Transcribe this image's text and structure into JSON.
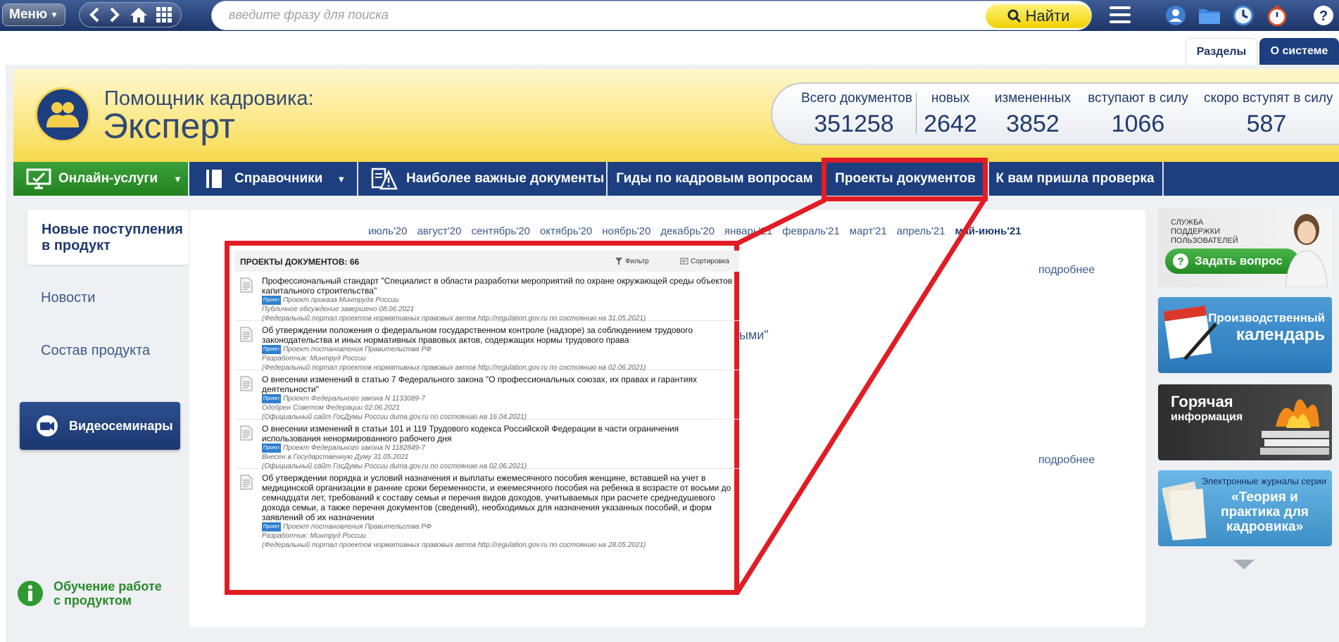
{
  "toolbar": {
    "menu_label": "Меню",
    "search_placeholder": "введите фразу для поиска",
    "search_button": "Найти"
  },
  "tabs": {
    "razdely": "Разделы",
    "o_sisteme": "О системе"
  },
  "brand": {
    "subtitle": "Помощник кадровика:",
    "title": "Эксперт"
  },
  "stats": [
    {
      "label": "Всего документов",
      "value": "351258"
    },
    {
      "label": "новых",
      "value": "2642"
    },
    {
      "label": "измененных",
      "value": "3852"
    },
    {
      "label": "вступают в силу",
      "value": "1066"
    },
    {
      "label": "скоро вступят в силу",
      "value": "587"
    }
  ],
  "nav": {
    "online": "Онлайн-услуги",
    "spravochniki": "Справочники",
    "important": "Наиболее важные документы",
    "guides": "Гиды по кадровым вопросам",
    "projects": "Проекты документов",
    "inspection": "К вам пришла проверка"
  },
  "sidebar": {
    "new_arrivals": "Новые поступления в продукт",
    "news": "Новости",
    "composition": "Состав продукта",
    "video": "Видеосеминары",
    "training": "Обучение работе с продуктом"
  },
  "months": [
    "июль'20",
    "август'20",
    "сентябрь'20",
    "октябрь'20",
    "ноябрь'20",
    "декабрь'20",
    "январь'21",
    "февраль'21",
    "март'21",
    "апрель'21",
    "май-июнь'21"
  ],
  "content": {
    "more1": "подробнее",
    "more2": "подробнее",
    "partial_text": "ными\""
  },
  "projects_panel": {
    "title": "ПРОЕКТЫ ДОКУМЕНТОВ: 66",
    "filter": "Фильтр",
    "sort": "Сортировка",
    "badge": "Проект",
    "items": [
      {
        "title": "Профессиональный стандарт \"Специалист в области разработки мероприятий по охране окружающей среды объектов капитального строительства\"",
        "kind": "Проект приказа Минтруда России",
        "status": "Публичное обсуждение завершено 08.06.2021",
        "source": "(Федеральный портал проектов нормативных правовых актов http://regulation.gov.ru по состоянию на 31.05.2021)"
      },
      {
        "title": "Об утверждении положения о федеральном государственном контроле (надзоре) за соблюдением трудового законодательства и иных нормативных правовых актов, содержащих нормы трудового права",
        "kind": "Проект постановления Правительства РФ",
        "status": "Разработчик: Минтруд России",
        "source": "(Федеральный портал проектов нормативных правовых актов http://regulation.gov.ru по состоянию на 02.06.2021)"
      },
      {
        "title": "О внесении изменений в статью 7 Федерального закона \"О профессиональных союзах, их правах и гарантиях деятельности\"",
        "kind": "Проект Федерального закона N 1133089-7",
        "status": "Одобрен Советом Федерации 02.06.2021",
        "source": "(Официальный сайт ГосДумы России duma.gov.ru по состоянию на 16.04.2021)"
      },
      {
        "title": "О внесении изменений в статьи 101 и 119 Трудового кодекса Российской Федерации в части ограничения использования ненормированного рабочего дня",
        "kind": "Проект Федерального закона N 1182849-7",
        "status": "Внесен в Государственную Думу 31.05.2021",
        "source": "(Официальный сайт ГосДумы России duma.gov.ru по состоянию на 02.06.2021)"
      },
      {
        "title": "Об утверждении порядка и условий назначения и выплаты ежемесячного пособия женщине, вставшей на учет в медицинской организации в ранние сроки беременности, и ежемесячного пособия на ребенка в возрасте от восьми до семнадцати лет, требований к составу семьи и перечня видов доходов, учитываемых при расчете среднедушевого дохода семьи, а также перечня документов (сведений), необходимых для назначения указанных пособий, и форм заявлений об их назначении",
        "kind": "Проект постановления Правительства РФ",
        "status": "Разработчик: Минтруд России",
        "source": "(Федеральный портал проектов нормативных правовых актов http://regulation.gov.ru по состоянию на 28.05.2021)"
      }
    ]
  },
  "right_cards": {
    "support_title": "СЛУЖБА ПОДДЕРЖКИ ПОЛЬЗОВАТЕЛЕЙ",
    "support_button": "Задать вопрос",
    "calendar_line1": "Производственный",
    "calendar_line2": "календарь",
    "hot_line1": "Горячая",
    "hot_line2": "информация",
    "journal_top": "Электронные журналы серии",
    "journal_main": "«Теория и практика для кадровика»"
  }
}
